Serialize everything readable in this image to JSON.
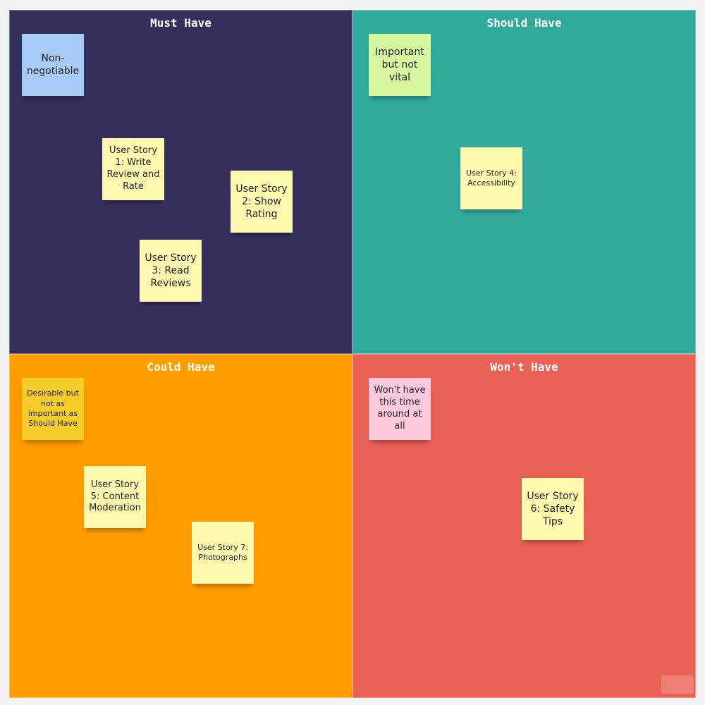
{
  "colors": {
    "page_background": "#f2f2f2",
    "must_have": "#33305c",
    "should_have": "#31aa9b",
    "could_have": "#ff9c00",
    "wont_have": "#e96054",
    "note_yellow": "#fff9b0",
    "note_blue": "#a8cbf5",
    "note_green": "#d7f79e",
    "note_gold": "#f6cc2a",
    "note_pink": "#ffc8dc",
    "watermark_bg": "#ef7f76"
  },
  "quadrants": {
    "must": {
      "title": "Must Have"
    },
    "should": {
      "title": "Should Have"
    },
    "could": {
      "title": "Could Have"
    },
    "wont": {
      "title": "Won't Have"
    }
  },
  "notes": {
    "non_negotiable": "Non-negotiable",
    "important_not_vital": "Important but not vital",
    "desirable": "Desirable but not as important as Should Have",
    "wont_this_time": "Won't have this time around at all",
    "story1": "User Story 1: Write Review and Rate",
    "story2": "User Story 2: Show Rating",
    "story3": "User Story 3: Read Reviews",
    "story4": "User Story 4: Accessibility",
    "story5": "User Story 5: Content Moderation",
    "story6": "User Story 6: Safety Tips",
    "story7": "User Story 7: Photographs"
  }
}
